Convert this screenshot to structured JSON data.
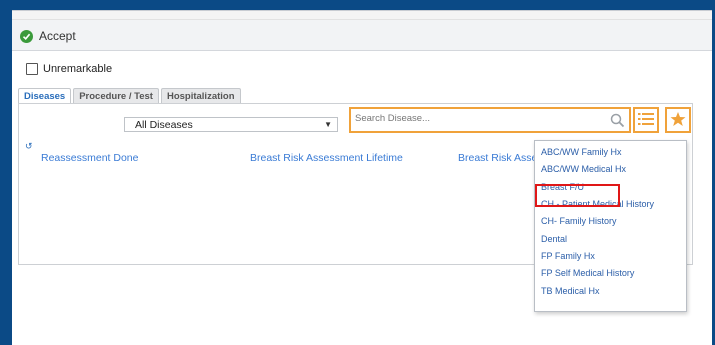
{
  "toolbar": {
    "accept_label": "Accept"
  },
  "unremarkable": {
    "label": "Unremarkable",
    "checked": false
  },
  "tabs": [
    {
      "label": "Diseases",
      "active": true
    },
    {
      "label": "Procedure / Test",
      "active": false
    },
    {
      "label": "Hospitalization",
      "active": false
    }
  ],
  "filter": {
    "selected": "All Diseases"
  },
  "search": {
    "placeholder": "Search Disease..."
  },
  "diseases": [
    {
      "label": "Reassessment Done"
    },
    {
      "label": "Breast Risk Assessment Lifetime"
    },
    {
      "label": "Breast Risk Asses"
    }
  ],
  "dropdown": {
    "items": [
      {
        "label": "ABC/WW Family Hx"
      },
      {
        "label": "ABC/WW Medical Hx"
      },
      {
        "label": "Breast F/U",
        "highlighted": true
      },
      {
        "label": "CH - Patient Medical History"
      },
      {
        "label": "CH- Family History"
      },
      {
        "label": "Dental"
      },
      {
        "label": "FP Family Hx"
      },
      {
        "label": "FP Self Medical History"
      },
      {
        "label": "TB Medical Hx"
      }
    ]
  },
  "colors": {
    "background": "#0b4a86",
    "accent_orange": "#f0a23a",
    "link_blue": "#3a7bd5",
    "highlight_red": "#e01717",
    "accept_green": "#3b9a3b"
  }
}
